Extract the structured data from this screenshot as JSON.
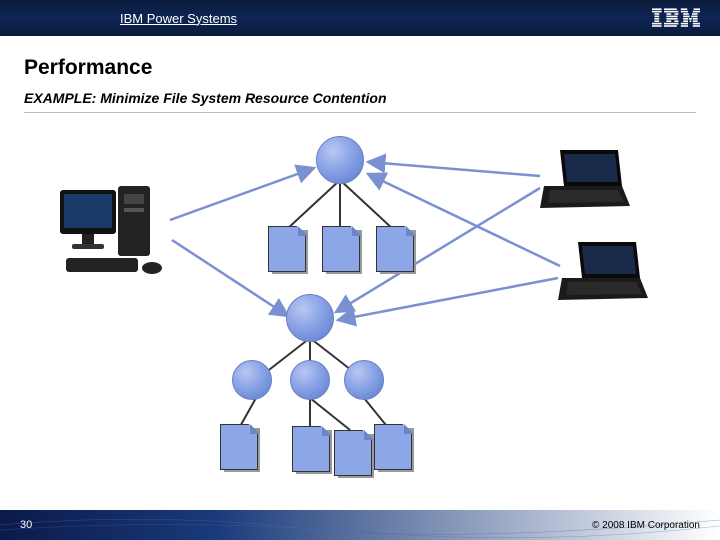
{
  "header": {
    "title": "IBM Power Systems",
    "logo": "IBM"
  },
  "content": {
    "title": "Performance",
    "subtitle": "EXAMPLE: Minimize File System Resource Contention"
  },
  "footer": {
    "page": "30",
    "copyright": "© 2008 IBM Corporation"
  },
  "diagram": {
    "description": "Two tree clusters each with a root sphere connected to child document nodes; a desktop computer on the left and two laptops on the right connect across clusters",
    "clusters": [
      {
        "root": "sphere",
        "children": [
          "doc",
          "doc",
          "doc"
        ]
      },
      {
        "root": "sphere",
        "children_spheres": 3,
        "children_docs": [
          "doc",
          "doc",
          "doc"
        ]
      }
    ],
    "clients": [
      "desktop",
      "laptop",
      "laptop"
    ]
  }
}
